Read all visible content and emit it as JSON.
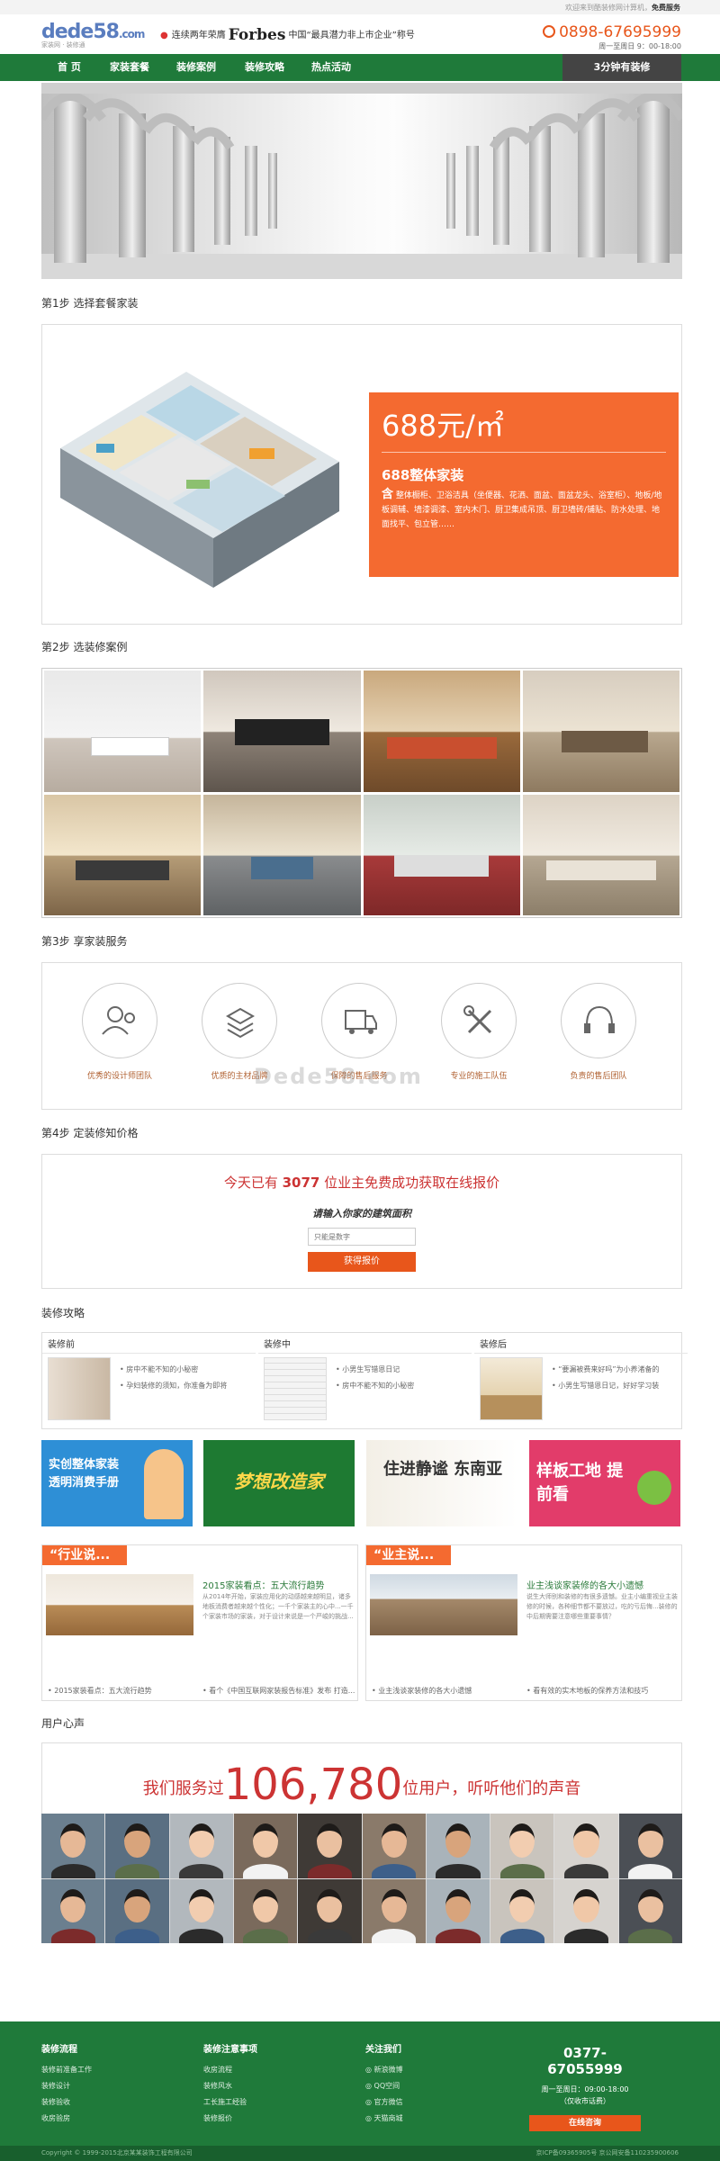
{
  "topbar": {
    "welcome": "欢迎来到酷装修网计算机，",
    "free": "免费服务"
  },
  "logo": {
    "text": "dede58",
    "suffix": ".com",
    "sub": "家装网 · 装修通"
  },
  "header": {
    "forbes_pre": "连续两年荣膺",
    "forbes_brand": "Forbes",
    "forbes_post": "中国“最具潜力非上市企业”称号",
    "phone": "0898-67695999",
    "hours": "周一至周日 9：00-18:00"
  },
  "nav": {
    "items": [
      "首 页",
      "家装套餐",
      "装修案例",
      "装修攻略",
      "热点活动"
    ],
    "cta": "3分钟有装修"
  },
  "steps": {
    "s1": "第1步 选择套餐家装",
    "s2": "第2步 选装修案例",
    "s3": "第3步 享家装服务",
    "s4": "第4步 定装修知价格"
  },
  "package": {
    "price": "688",
    "unit": "元/㎡",
    "title": "688整体家装",
    "desc_lead": "含",
    "desc": "整体橱柜、卫浴洁具（坐便器、花洒、面盆、面盆龙头、浴室柜）、地板/地板调辅、墙漆调漆、室内木门、厨卫集成吊顶、厨卫墙砖/铺贴、防水处理、地面找平、包立管……"
  },
  "services": [
    "优秀的设计师团队",
    "优质的主材品牌",
    "保障的售后服务",
    "专业的施工队伍",
    "负责的售后团队"
  ],
  "watermark": "Dede58.com",
  "quote": {
    "head_pre": "今天已有",
    "count": "3077",
    "head_post": "位业主免费成功获取在线报价",
    "sub": "请输入你家的建筑面积",
    "placeholder": "只能是数字",
    "button": "获得报价"
  },
  "guide": {
    "title": "装修攻略",
    "cols": [
      {
        "head": "装修前",
        "items": [
          "• 房中不能不知的小秘密",
          "• 孕妇装修的须知，你准备为即将"
        ]
      },
      {
        "head": "装修中",
        "items": [
          "• 小男生写错恩日记",
          "• 房中不能不知的小秘密"
        ]
      },
      {
        "head": "装修后",
        "items": [
          "• “要漏被费来好吗”为小养渚备的",
          "• 小男生写错恩日记，好好学习装"
        ]
      }
    ]
  },
  "banners": [
    "实创整体家装 透明消费手册",
    "梦想改造家",
    "住进静谧 东南亚",
    "样板工地 提前看"
  ],
  "news": [
    {
      "tag": "“行业说...",
      "title": "2015家装看点：五大流行趋势",
      "text": "从2014年开始，家装应用化的动感越来越明显，诸多地板消费者越来越个性化；一千个家装主的心中...一千个家装市场的家装，对于设计来说是一个严峻的挑战...",
      "links": [
        "• 2015家装看点：五大流行趋势",
        "• 看个《中国互联网家装报告标准》发布 打造..."
      ]
    },
    {
      "tag": "“业主说...",
      "title": "业主浅谈家装修的各大小遗憾",
      "text": "说生大师别和装修的有很多遗憾。业主小编重视业主装修的时候，各种细节都不要放过，吃的亏后悔...装修的中后期需要注意哪些重要事情？",
      "links": [
        "• 业主浅谈家装修的各大小遗憾",
        "• 看有效的实木地板的保养方法和技巧"
      ]
    }
  ],
  "users": {
    "title": "用户心声",
    "pre": "我们服务过",
    "count": "106,780",
    "post": "位用户，听听他们的声音"
  },
  "footer": {
    "cols": [
      {
        "head": "装修流程",
        "items": [
          "装修前准备工作",
          "装修设计",
          "装修验收",
          "收房验房"
        ]
      },
      {
        "head": "装修注意事项",
        "items": [
          "收房流程",
          "装修风水",
          "工长施工经验",
          "装修报价"
        ]
      },
      {
        "head": "关注我们",
        "items": [
          "新浪微博",
          "QQ空间",
          "官方微信",
          "天猫商城"
        ]
      }
    ],
    "phone": "0377-67055999",
    "hours": "周一至周日：09:00-18:00",
    "note": "（仅收市话费）",
    "button": "在线咨询",
    "copyright": "Copyright © 1999-2015北京某某装饰工程有限公司",
    "icp": "京ICP备09365905号 京公网安备110235900606"
  },
  "colors": {
    "green": "#1f7a3a",
    "orange": "#f46a30",
    "red": "#cc3333"
  }
}
